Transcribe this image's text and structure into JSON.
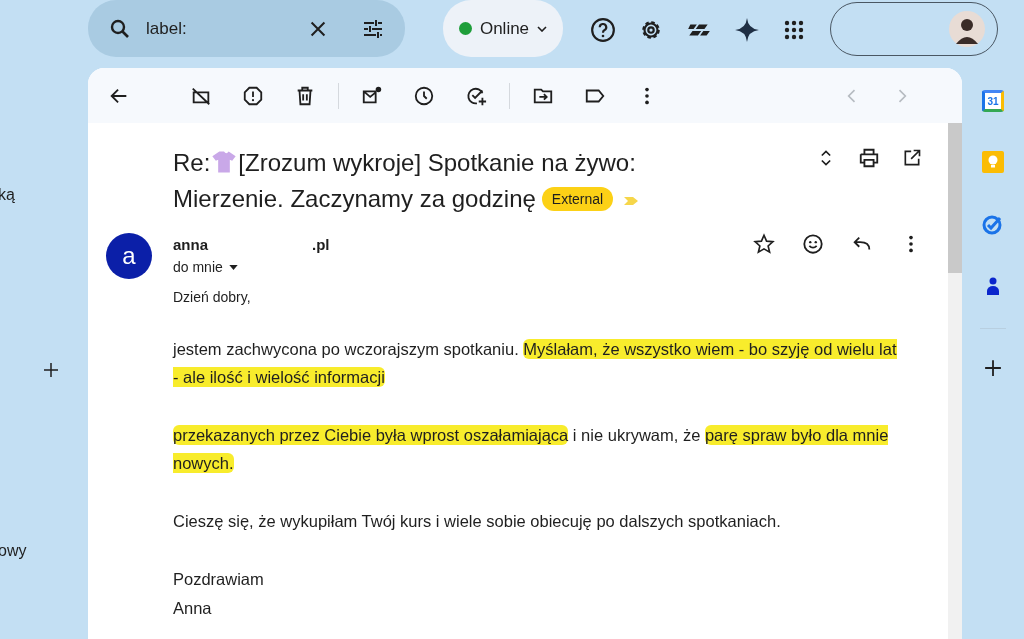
{
  "search": {
    "value": "label:"
  },
  "status": {
    "label": "Online",
    "online": true
  },
  "left_nav": [
    {
      "text": "ką"
    },
    {
      "text": "owy"
    }
  ],
  "subject": {
    "prefix": "Re:",
    "lines": [
      "[Zrozum wykroje] Spotkanie na żywo:",
      "Mierzenie. Zaczynamy za godzinę"
    ],
    "tag": "External",
    "important": true
  },
  "message": {
    "avatar": "a",
    "sender_start": "anna",
    "sender_end": ".pl",
    "to": "do mnie",
    "starred": false,
    "greeting": "Dzień dobry,",
    "paragraphs": [
      [
        {
          "text": "jestem zachwycona po wczorajszym spotkaniu. ",
          "highlighted": false
        },
        {
          "text": "Myślałam, że wszystko wiem - bo szyję od wielu lat - ale ilość i wielość informacji",
          "highlighted": true
        }
      ],
      [
        {
          "text": "przekazanych przez Ciebie była wprost oszałamiająca",
          "highlighted": true
        },
        {
          "text": " i nie ukrywam, że ",
          "highlighted": false
        },
        {
          "text": "parę spraw było dla mnie nowych.",
          "highlighted": true
        }
      ],
      [
        {
          "text": "Cieszę się, że wykupiłam Twój kurs i wiele sobie obiecuję po dalszych spotkaniach.",
          "highlighted": false
        }
      ]
    ],
    "closing": "Pozdrawiam",
    "signature": "Anna"
  },
  "rail": {
    "calendar_day": "31"
  }
}
